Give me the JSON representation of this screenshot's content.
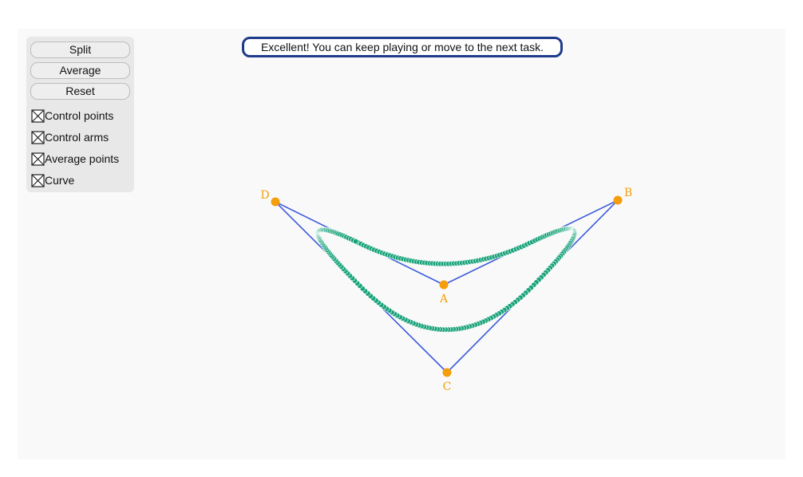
{
  "controls": {
    "buttons": [
      {
        "key": "split",
        "label": "Split"
      },
      {
        "key": "average",
        "label": "Average"
      },
      {
        "key": "reset",
        "label": "Reset"
      }
    ],
    "checkboxes": [
      {
        "key": "control-points",
        "label": "Control points",
        "checked": true
      },
      {
        "key": "control-arms",
        "label": "Control arms",
        "checked": true
      },
      {
        "key": "average-points",
        "label": "Average points",
        "checked": true
      },
      {
        "key": "curve",
        "label": "Curve",
        "checked": true
      }
    ]
  },
  "message": "Excellent! You can keep playing or move to the next task.",
  "control_points": {
    "labels": [
      "A",
      "B",
      "C",
      "D"
    ]
  },
  "colors": {
    "control_point": "#f59e0b",
    "control_arm": "#3b5bdb",
    "curve_point": "#1aa37a",
    "banner_border": "#1e3a8a"
  }
}
